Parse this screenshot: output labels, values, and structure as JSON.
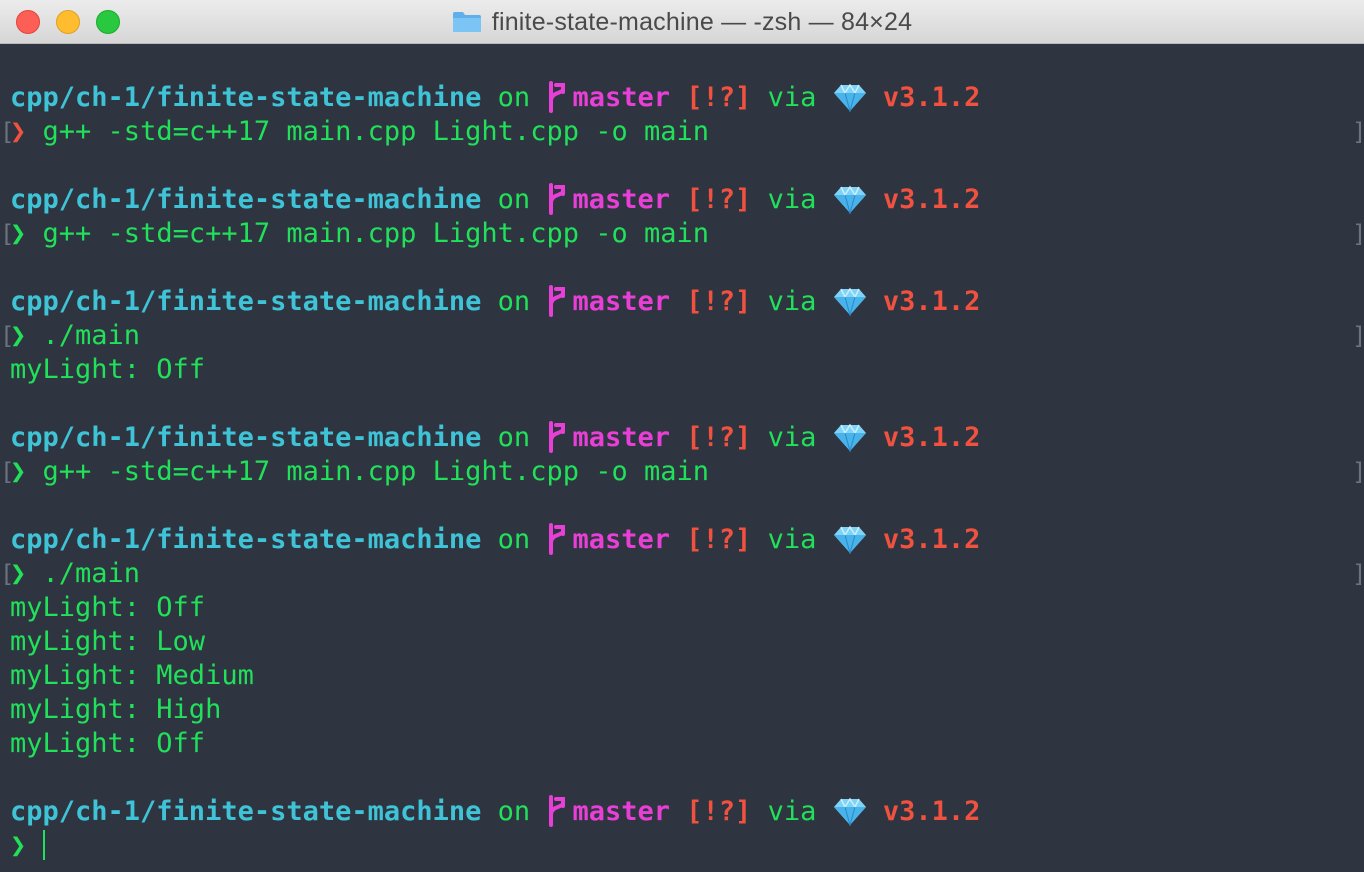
{
  "window": {
    "title": "finite-state-machine — -zsh — 84×24"
  },
  "prompt": {
    "path": "cpp/ch-1/finite-state-machine",
    "on": "on",
    "branch_icon": "",
    "branch": "master",
    "status": "[!?]",
    "via": "via",
    "gem_icon": "gem-icon",
    "version": "v3.1.2",
    "symbol": "❯"
  },
  "blocks": [
    {
      "symbol_color": "red",
      "command": "g++ -std=c++17 main.cpp Light.cpp -o main",
      "output": []
    },
    {
      "symbol_color": "green",
      "command": "g++ -std=c++17 main.cpp Light.cpp -o main",
      "output": []
    },
    {
      "symbol_color": "green",
      "command": "./main",
      "output": [
        "myLight: Off"
      ]
    },
    {
      "symbol_color": "green",
      "command": "g++ -std=c++17 main.cpp Light.cpp -o main",
      "output": []
    },
    {
      "symbol_color": "green",
      "command": "./main",
      "output": [
        "myLight: Off",
        "myLight: Low",
        "myLight: Medium",
        "myLight: High",
        "myLight: Off"
      ]
    }
  ],
  "final_prompt": {
    "symbol_color": "green"
  },
  "colors": {
    "background": "#2e3440",
    "path": "#3fc3d6",
    "text": "#21e05a",
    "branch": "#e83fd6",
    "status": "#f0523f"
  }
}
